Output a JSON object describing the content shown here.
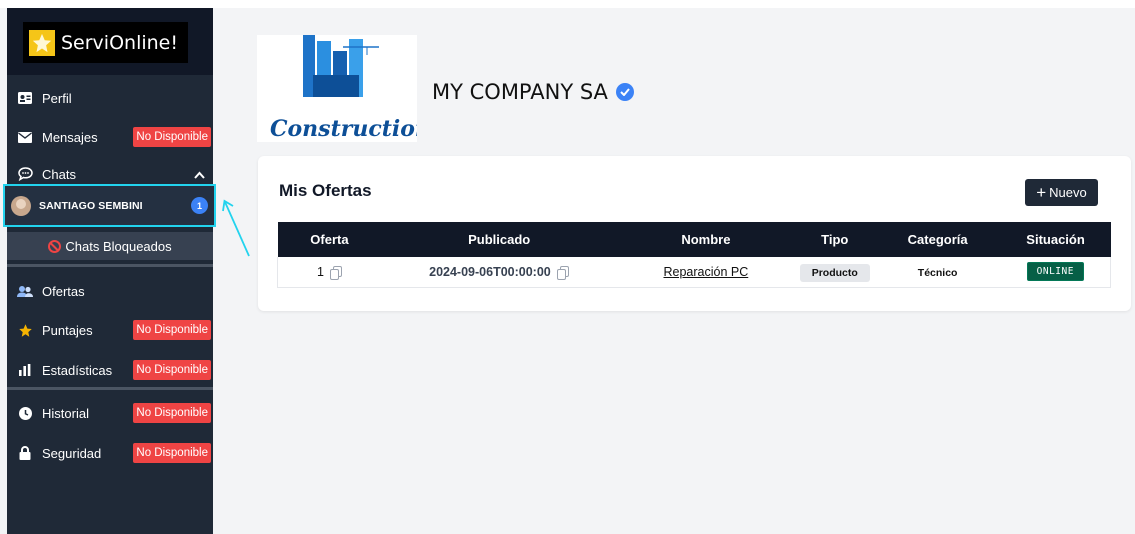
{
  "brand": {
    "name": "ServiOnline!"
  },
  "sidebar": {
    "items": [
      {
        "label": "Perfil",
        "icon": "id-card-icon"
      },
      {
        "label": "Mensajes",
        "icon": "envelope-icon",
        "badge": "No Disponible"
      },
      {
        "label": "Chats",
        "icon": "chat-bubble-icon"
      },
      {
        "label": "Ofertas",
        "icon": "users-icon"
      },
      {
        "label": "Puntajes",
        "icon": "star-icon",
        "badge": "No Disponible"
      },
      {
        "label": "Estadísticas",
        "icon": "bar-chart-icon",
        "badge": "No Disponible"
      },
      {
        "label": "Historial",
        "icon": "clock-icon",
        "badge": "No Disponible"
      },
      {
        "label": "Seguridad",
        "icon": "lock-icon",
        "badge": "No Disponible"
      }
    ],
    "chat_user": {
      "name": "SANTIAGO SEMBINI",
      "unread": "1"
    },
    "blocked_label": "Chats Bloqueados"
  },
  "company": {
    "name": "MY COMPANY SA",
    "logo_text": "Construction"
  },
  "offers": {
    "title": "Mis Ofertas",
    "new_button": "Nuevo",
    "columns": [
      "Oferta",
      "Publicado",
      "Nombre",
      "Tipo",
      "Categoría",
      "Situación"
    ],
    "rows": [
      {
        "oferta": "1",
        "publicado": "2024-09-06T00:00:00",
        "nombre": "Reparación PC",
        "tipo": "Producto",
        "categoria": "Técnico",
        "situacion": "ONLINE"
      }
    ]
  },
  "colors": {
    "sidebar": "#1f2937",
    "danger": "#ef4444",
    "accent": "#22d3ee",
    "online": "#065f46"
  }
}
